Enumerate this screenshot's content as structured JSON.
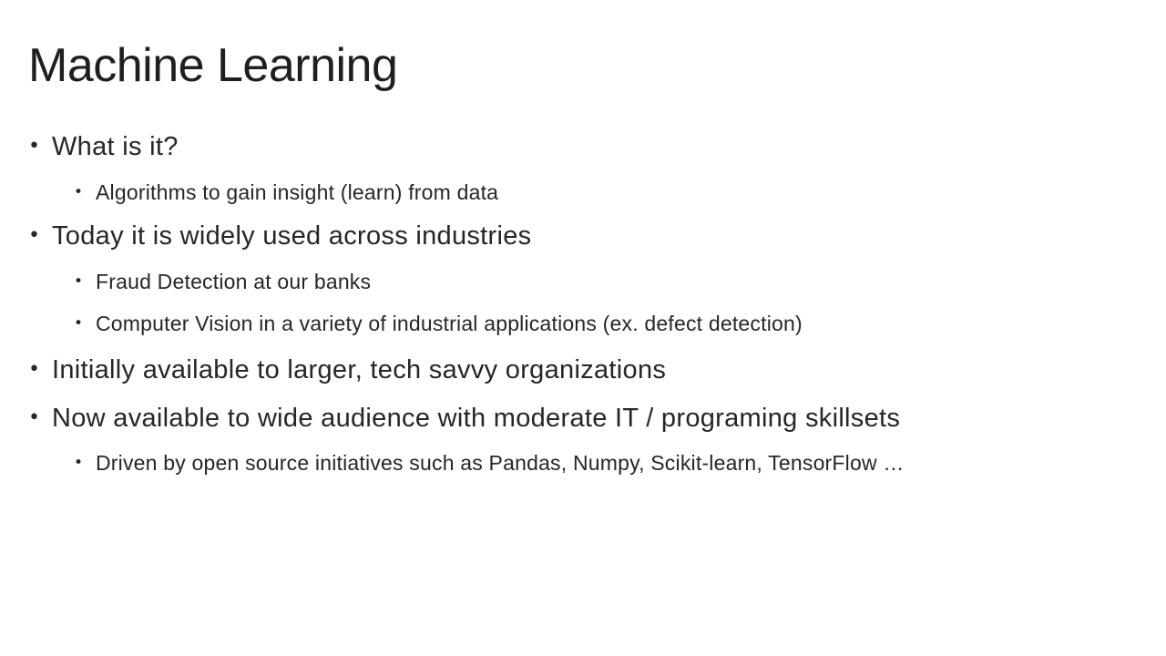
{
  "slide": {
    "title": "Machine Learning",
    "bullet_glyph": "•",
    "bullets": [
      {
        "text": "What is it?"
      },
      {
        "text": "Algorithms to gain insight (learn) from data"
      },
      {
        "text": "Today it is widely used across industries"
      },
      {
        "text": "Fraud Detection at our banks"
      },
      {
        "text": "Computer Vision in a variety of industrial applications (ex. defect detection)"
      },
      {
        "text": "Initially available to larger, tech savvy organizations"
      },
      {
        "text": "Now available to wide audience with moderate IT / programing skillsets"
      },
      {
        "text": "Driven by open source initiatives such as Pandas, Numpy, Scikit-learn, TensorFlow …"
      }
    ]
  }
}
